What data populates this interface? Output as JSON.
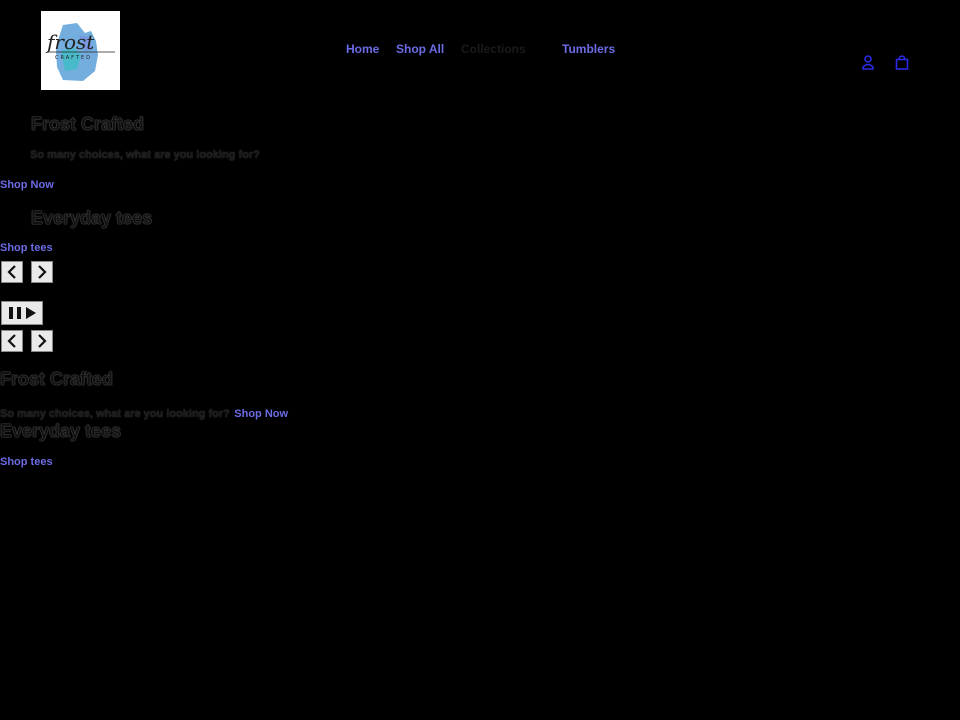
{
  "header": {
    "logo_alt": "Frost Crafted",
    "nav": {
      "home": "Home",
      "shop_all": "Shop All",
      "collections": "Collections",
      "tumblers": "Tumblers"
    },
    "icons": [
      "account-icon",
      "cart-icon"
    ]
  },
  "slideshow": {
    "slides": [
      {
        "heading": "Frost Crafted",
        "subheading": "So many choices, what are you looking for?",
        "link": "Shop Now"
      },
      {
        "heading": "Everyday tees",
        "link": "Shop tees"
      }
    ],
    "controls": [
      "chevron-left-icon",
      "chevron-right-icon",
      "pause-icon",
      "play-icon"
    ]
  },
  "colors": {
    "background": "#000000",
    "link": "#6c6ce6",
    "icon": "#2a2ae6"
  }
}
